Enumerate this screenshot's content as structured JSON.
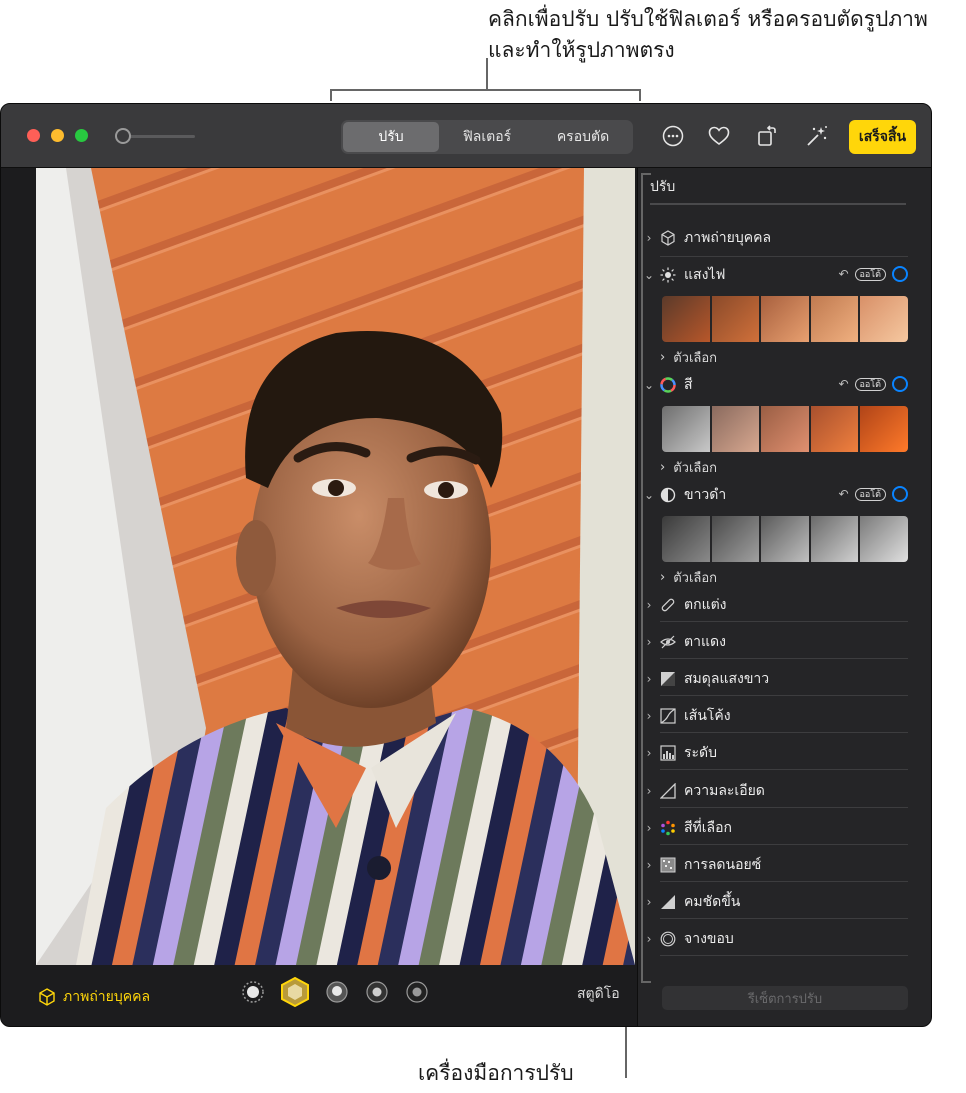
{
  "callouts": {
    "top": "คลิกเพื่อปรับ ปรับใช้ฟิลเตอร์ หรือครอบตัดรูปภาพและทำให้รูปภาพตรง",
    "bottom": "เครื่องมือการปรับ"
  },
  "toolbar": {
    "tabs": [
      "ปรับ",
      "ฟิลเตอร์",
      "ครอบตัด"
    ],
    "active_tab": "ปรับ",
    "done_label": "เสร็จสิ้น",
    "icons": [
      "more-icon",
      "heart-icon",
      "rotate-icon",
      "magic-wand-icon"
    ]
  },
  "bottom_bar": {
    "portrait_label": "ภาพถ่ายบุคคล",
    "lighting_label": "สตูดิโอ"
  },
  "sidebar": {
    "title": "ปรับ",
    "portrait_row": "ภาพถ่ายบุคคล",
    "sections": [
      {
        "label": "แสงไฟ",
        "auto": "ออโต้",
        "options": "ตัวเลือก"
      },
      {
        "label": "สี",
        "auto": "ออโต้",
        "options": "ตัวเลือก"
      },
      {
        "label": "ขาวดำ",
        "auto": "ออโต้",
        "options": "ตัวเลือก"
      }
    ],
    "tools": [
      "ตกแต่ง",
      "ตาแดง",
      "สมดุลแสงขาว",
      "เส้นโค้ง",
      "ระดับ",
      "ความละเอียด",
      "สีที่เลือก",
      "การลดนอยซ์",
      "คมชัดขึ้น",
      "จางขอบ"
    ],
    "reset_label": "รีเซ็ตการปรับ"
  },
  "colors": {
    "accent_yellow": "#ffd60a",
    "ring_blue": "#0a84ff",
    "window_bg": "#1c1c1e",
    "titlebar_bg": "#3a3a3c"
  }
}
